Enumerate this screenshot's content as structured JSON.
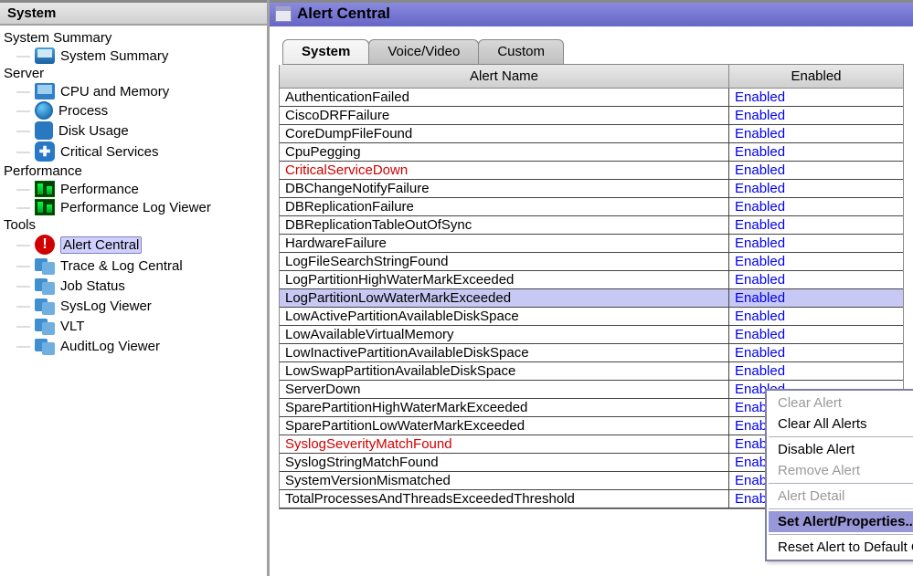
{
  "sidebar": {
    "title": "System",
    "sections": [
      {
        "label": "System Summary",
        "items": [
          {
            "label": "System Summary",
            "icon": "summary"
          }
        ]
      },
      {
        "label": "Server",
        "items": [
          {
            "label": "CPU and Memory",
            "icon": "cpu"
          },
          {
            "label": "Process",
            "icon": "process"
          },
          {
            "label": "Disk Usage",
            "icon": "disk"
          },
          {
            "label": "Critical Services",
            "icon": "critical"
          }
        ]
      },
      {
        "label": "Performance",
        "items": [
          {
            "label": "Performance",
            "icon": "perf"
          },
          {
            "label": "Performance Log Viewer",
            "icon": "perf"
          }
        ]
      },
      {
        "label": "Tools",
        "items": [
          {
            "label": "Alert Central",
            "icon": "alert",
            "selected": true
          },
          {
            "label": "Trace & Log Central",
            "icon": "tool"
          },
          {
            "label": "Job Status",
            "icon": "tool"
          },
          {
            "label": "SysLog Viewer",
            "icon": "tool"
          },
          {
            "label": "VLT",
            "icon": "tool"
          },
          {
            "label": "AuditLog Viewer",
            "icon": "tool"
          }
        ]
      }
    ]
  },
  "main": {
    "title": "Alert Central",
    "tabs": [
      {
        "label": "System",
        "active": true
      },
      {
        "label": "Voice/Video",
        "active": false
      },
      {
        "label": "Custom",
        "active": false
      }
    ],
    "columns": {
      "name": "Alert Name",
      "status": "Enabled"
    },
    "alerts": [
      {
        "name": "AuthenticationFailed",
        "status": "Enabled",
        "critical": false
      },
      {
        "name": "CiscoDRFFailure",
        "status": "Enabled",
        "critical": false
      },
      {
        "name": "CoreDumpFileFound",
        "status": "Enabled",
        "critical": false
      },
      {
        "name": "CpuPegging",
        "status": "Enabled",
        "critical": false
      },
      {
        "name": "CriticalServiceDown",
        "status": "Enabled",
        "critical": true
      },
      {
        "name": "DBChangeNotifyFailure",
        "status": "Enabled",
        "critical": false
      },
      {
        "name": "DBReplicationFailure",
        "status": "Enabled",
        "critical": false
      },
      {
        "name": "DBReplicationTableOutOfSync",
        "status": "Enabled",
        "critical": false
      },
      {
        "name": "HardwareFailure",
        "status": "Enabled",
        "critical": false
      },
      {
        "name": "LogFileSearchStringFound",
        "status": "Enabled",
        "critical": false
      },
      {
        "name": "LogPartitionHighWaterMarkExceeded",
        "status": "Enabled",
        "critical": false
      },
      {
        "name": "LogPartitionLowWaterMarkExceeded",
        "status": "Enabled",
        "critical": false,
        "selected": true
      },
      {
        "name": "LowActivePartitionAvailableDiskSpace",
        "status": "Enabled",
        "critical": false,
        "truncated_name": "LowActivePartitionAvailable",
        "truncated_status": "habled"
      },
      {
        "name": "LowAvailableVirtualMemory",
        "status": "Enabled",
        "critical": false,
        "truncated_name": "LowAvailableVirtualMemory",
        "truncated_status": "habled"
      },
      {
        "name": "LowInactivePartitionAvailableDiskSpace",
        "status": "Enabled",
        "critical": false,
        "truncated_name": "LowInactivePartitionAvailab",
        "truncated_status": "habled"
      },
      {
        "name": "LowSwapPartitionAvailableDiskSpace",
        "status": "Enabled",
        "critical": false,
        "truncated_name": "LowSwapPartitionAvailable",
        "truncated_status": "habled"
      },
      {
        "name": "ServerDown",
        "status": "Enabled",
        "critical": false,
        "truncated_name": "ServerDown",
        "truncated_status": "habled"
      },
      {
        "name": "SparePartitionHighWaterMarkExceeded",
        "status": "Enabled",
        "critical": false,
        "truncated_name": "SparePartitionHighWaterMa",
        "truncated_status": "habled"
      },
      {
        "name": "SparePartitionLowWaterMarkExceeded",
        "status": "Enabled",
        "critical": false,
        "truncated_name": "SparePartitionLowWaterMar",
        "truncated_status": "habled"
      },
      {
        "name": "SyslogSeverityMatchFound",
        "status": "Enabled",
        "critical": true,
        "truncated_name": "SyslogSeverityMatchFound",
        "truncated_status": "habled"
      },
      {
        "name": "SyslogStringMatchFound",
        "status": "Enabled",
        "critical": false
      },
      {
        "name": "SystemVersionMismatched",
        "status": "Enabled",
        "critical": false
      },
      {
        "name": "TotalProcessesAndThreadsExceededThreshold",
        "status": "Enabled",
        "critical": false
      }
    ],
    "context_menu": [
      {
        "label": "Clear Alert",
        "disabled": true
      },
      {
        "label": "Clear All Alerts",
        "disabled": false
      },
      {
        "sep": true
      },
      {
        "label": "Disable Alert",
        "disabled": false
      },
      {
        "label": "Remove Alert",
        "disabled": true
      },
      {
        "sep": true
      },
      {
        "label": "Alert Detail",
        "disabled": true
      },
      {
        "sep": true
      },
      {
        "label": "Set Alert/Properties...",
        "disabled": false,
        "selected": true
      },
      {
        "sep": true
      },
      {
        "label": "Reset Alert to Default Config",
        "disabled": false
      }
    ]
  }
}
